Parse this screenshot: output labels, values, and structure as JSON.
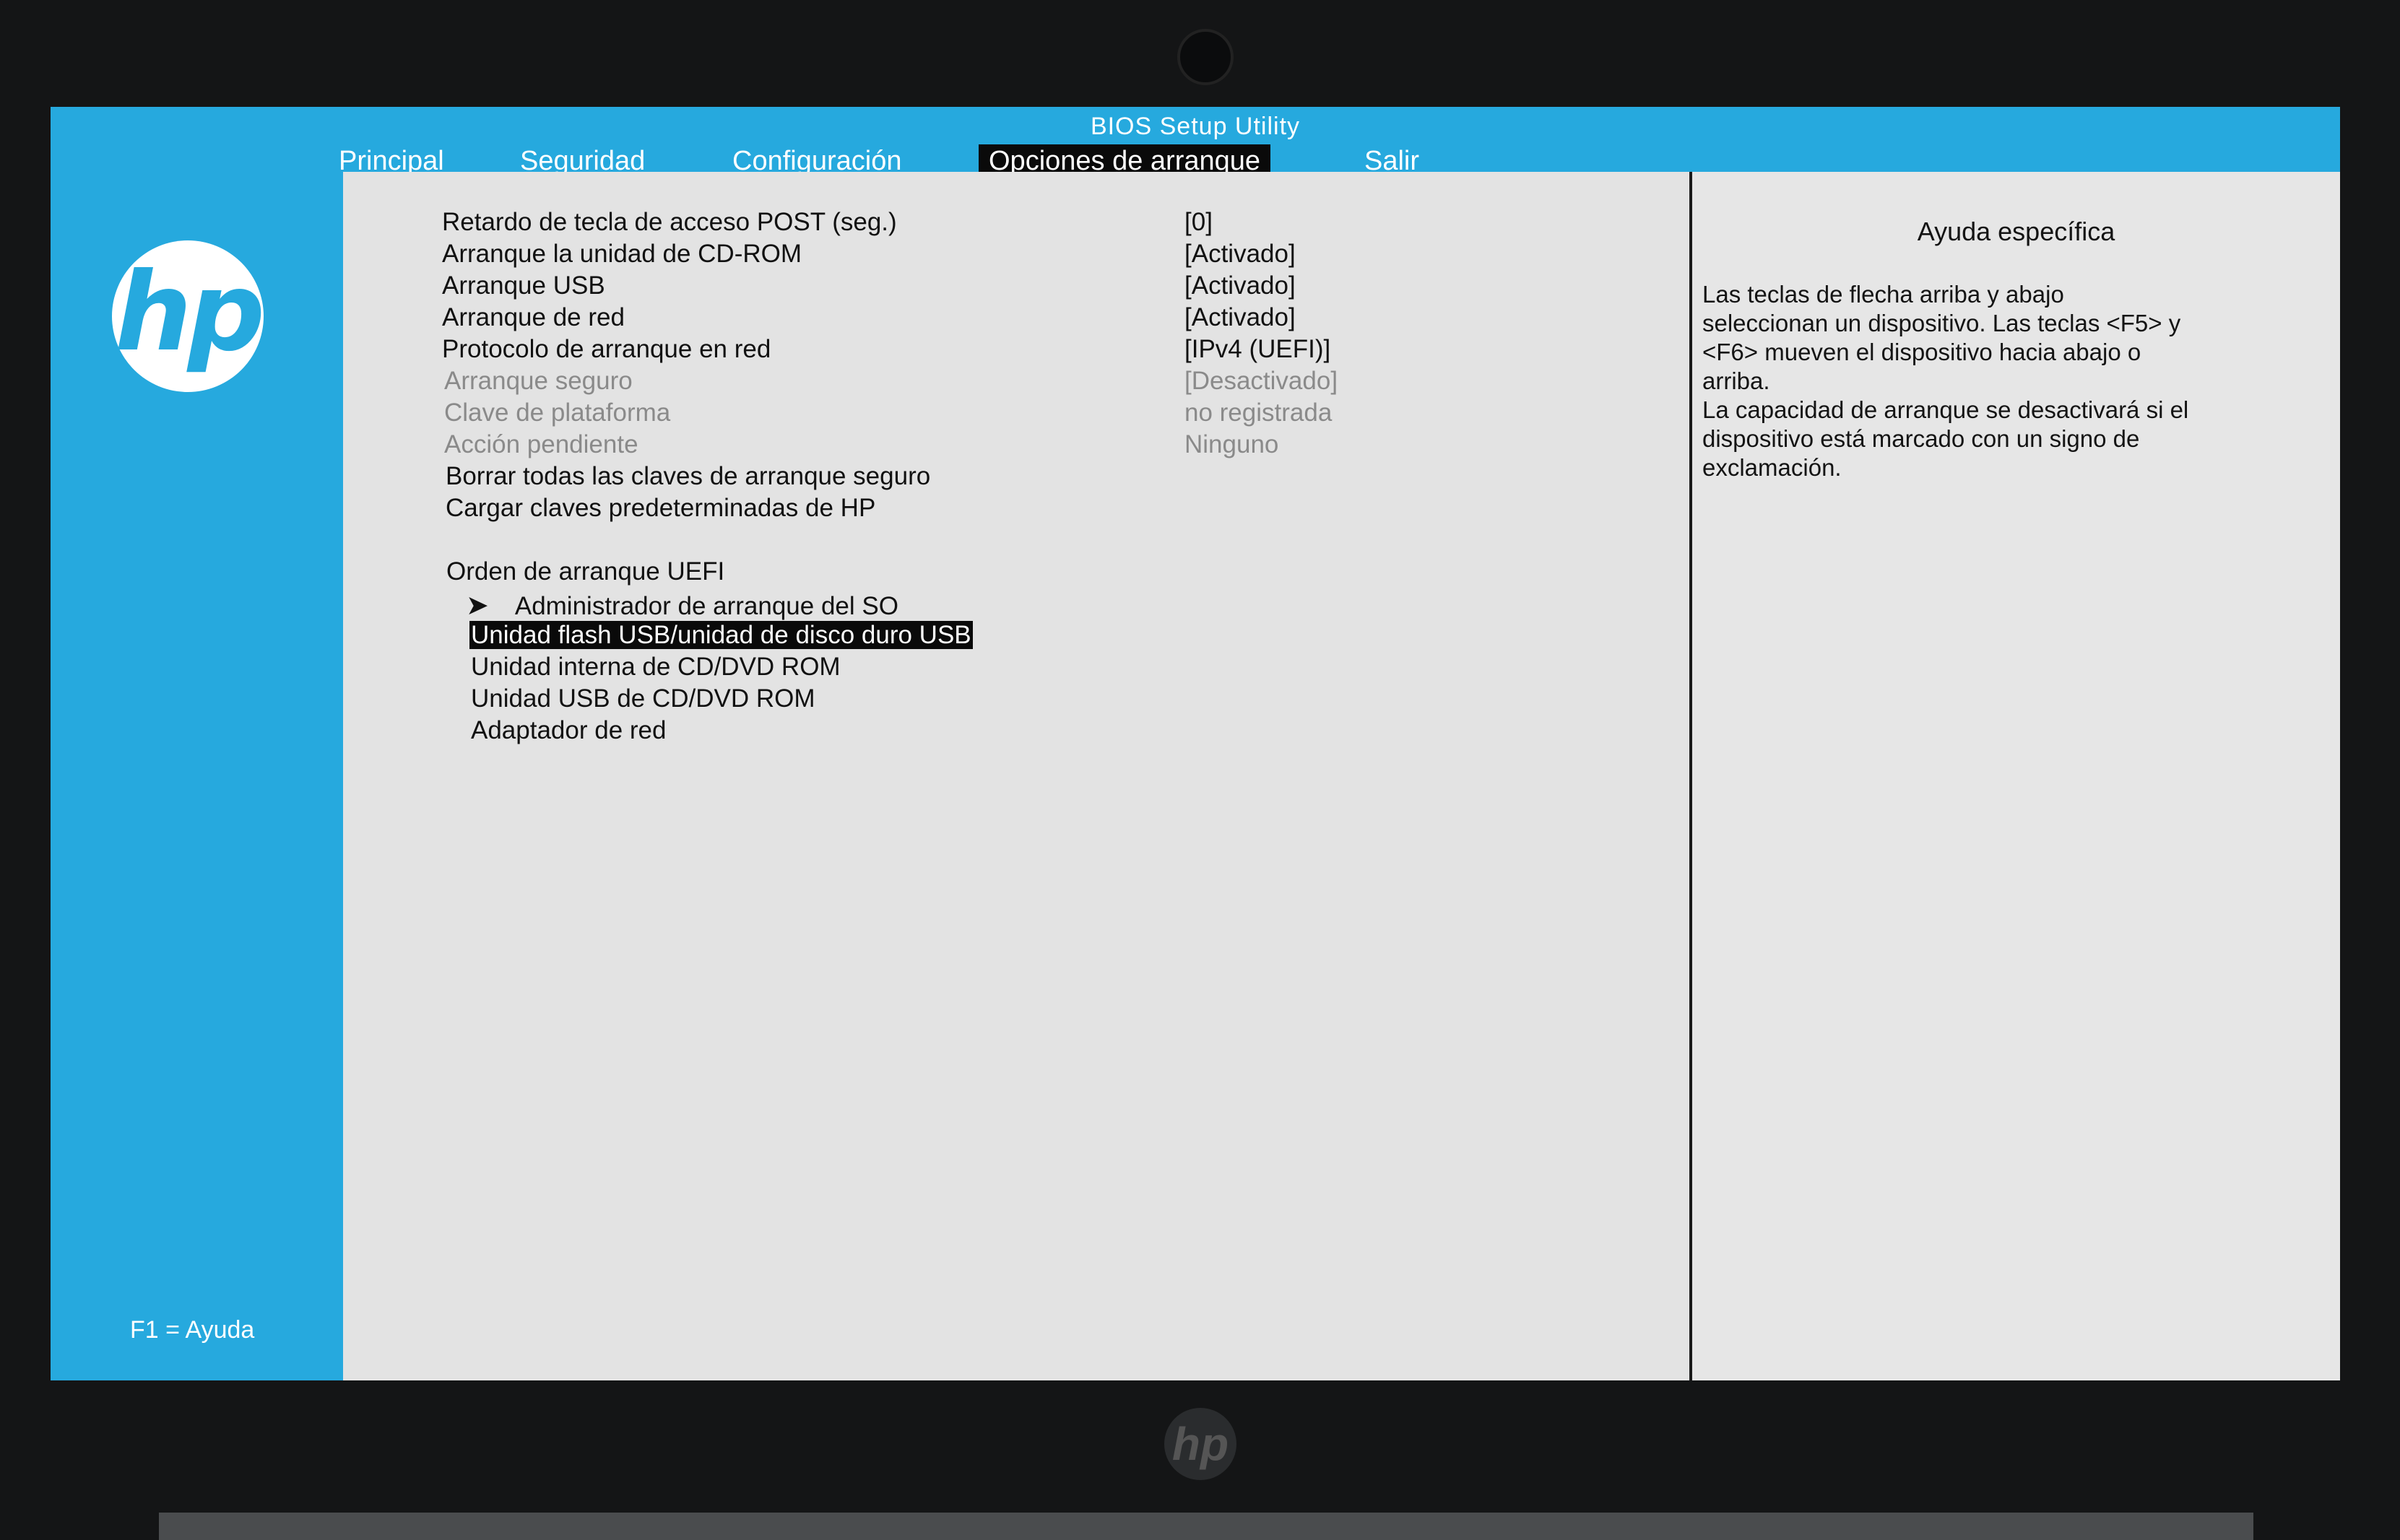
{
  "header": {
    "title": "BIOS Setup Utility"
  },
  "tabs": [
    {
      "label": "Principal"
    },
    {
      "label": "Seguridad"
    },
    {
      "label": "Configuración"
    },
    {
      "label": "Opciones de arranque"
    },
    {
      "label": "Salir"
    }
  ],
  "sidebar": {
    "logo_text": "hp",
    "help_hint": "F1 = Ayuda"
  },
  "settings": [
    {
      "label": "Retardo de tecla de acceso POST (seg.)",
      "value": "[0]"
    },
    {
      "label": "Arranque la unidad de CD-ROM",
      "value": "[Activado]"
    },
    {
      "label": "Arranque USB",
      "value": "[Activado]"
    },
    {
      "label": "Arranque de red",
      "value": "[Activado]"
    },
    {
      "label": "Protocolo de arranque en red",
      "value": "[IPv4 (UEFI)]"
    },
    {
      "label": "Arranque seguro",
      "value": "[Desactivado]"
    },
    {
      "label": "Clave de plataforma",
      "value": "no registrada"
    },
    {
      "label": "Acción pendiente",
      "value": "Ninguno"
    },
    {
      "label": "Borrar todas las claves de arranque seguro",
      "value": ""
    },
    {
      "label": "Cargar claves predeterminadas de HP",
      "value": ""
    }
  ],
  "boot_order": {
    "title": "Orden de arranque UEFI",
    "items": [
      {
        "label": "Administrador de arranque del SO"
      },
      {
        "label": "Unidad flash USB/unidad de disco duro USB"
      },
      {
        "label": "Unidad interna de CD/DVD ROM"
      },
      {
        "label": "Unidad USB de CD/DVD ROM"
      },
      {
        "label": "Adaptador de red"
      }
    ]
  },
  "help": {
    "title": "Ayuda específica",
    "text": "Las teclas de flecha arriba y abajo\nseleccionan un dispositivo. Las teclas <F5> y\n<F6> mueven el dispositivo hacia abajo o\narriba.\nLa capacidad de arranque se desactivará si el\ndispositivo está marcado con un signo de\nexclamación."
  },
  "icons": {
    "arrow": "arrow-right-icon"
  },
  "colors": {
    "accent": "#26a9de",
    "panel": "#e3e3e3",
    "selection": "#0a0a0a"
  }
}
